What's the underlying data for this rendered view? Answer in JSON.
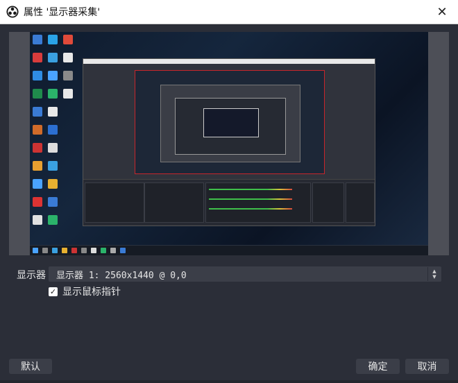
{
  "window": {
    "title": "属性 '显示器采集'",
    "close_glyph": "✕"
  },
  "form": {
    "display_label": "显示器",
    "display_value": "显示器 1: 2560x1440 @ 0,0",
    "show_cursor_label": "显示鼠标指针",
    "show_cursor_checked": true,
    "check_glyph": "✓"
  },
  "buttons": {
    "defaults": "默认",
    "ok": "确定",
    "cancel": "取消"
  },
  "icons": {
    "app": "obs-logo-icon",
    "close": "close-icon",
    "dropdown": "spinner-arrows-icon",
    "checkbox": "checkmark-icon"
  },
  "colors": {
    "dialog_bg": "#2b2e38",
    "control_bg": "#3b3e48",
    "titlebar_bg": "#ffffff",
    "preview_frame": "#4d4f57",
    "recording_border": "#c9252b"
  }
}
